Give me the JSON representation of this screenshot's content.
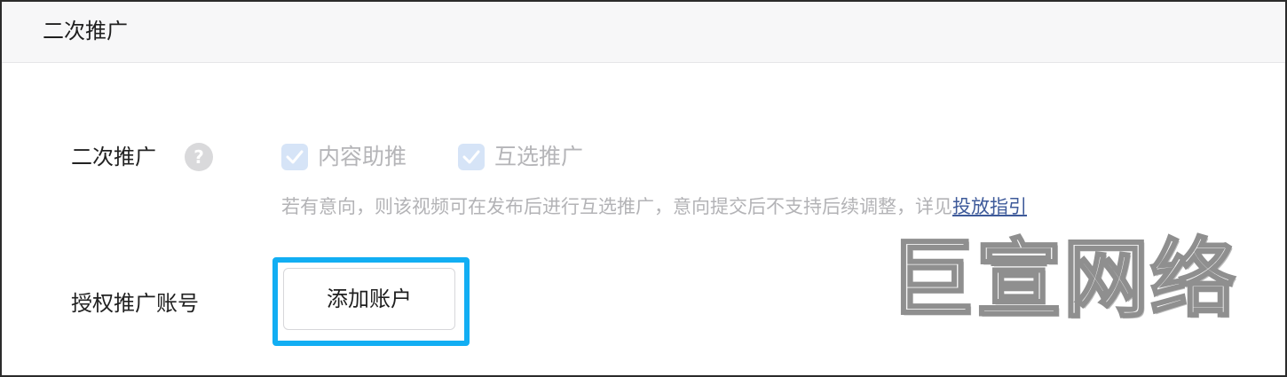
{
  "header": {
    "title": "二次推广"
  },
  "promotion": {
    "label": "二次推广",
    "help_icon": "question-mark-icon",
    "help_glyph": "?",
    "options": [
      {
        "label": "内容助推",
        "checked": true,
        "disabled": true
      },
      {
        "label": "互选推广",
        "checked": true,
        "disabled": true
      }
    ],
    "hint_text": "若有意向，则该视频可在发布后进行互选推广，意向提交后不支持后续调整，详见",
    "hint_link": "投放指引"
  },
  "account": {
    "label": "授权推广账号",
    "add_button_label": "添加账户"
  },
  "watermark": {
    "text": "巨宣网络"
  },
  "colors": {
    "focus_ring": "#12aef3",
    "checkbox_fill": "#d6e4f7",
    "link": "#3e5a9a",
    "muted_text": "#b3b3b6"
  }
}
